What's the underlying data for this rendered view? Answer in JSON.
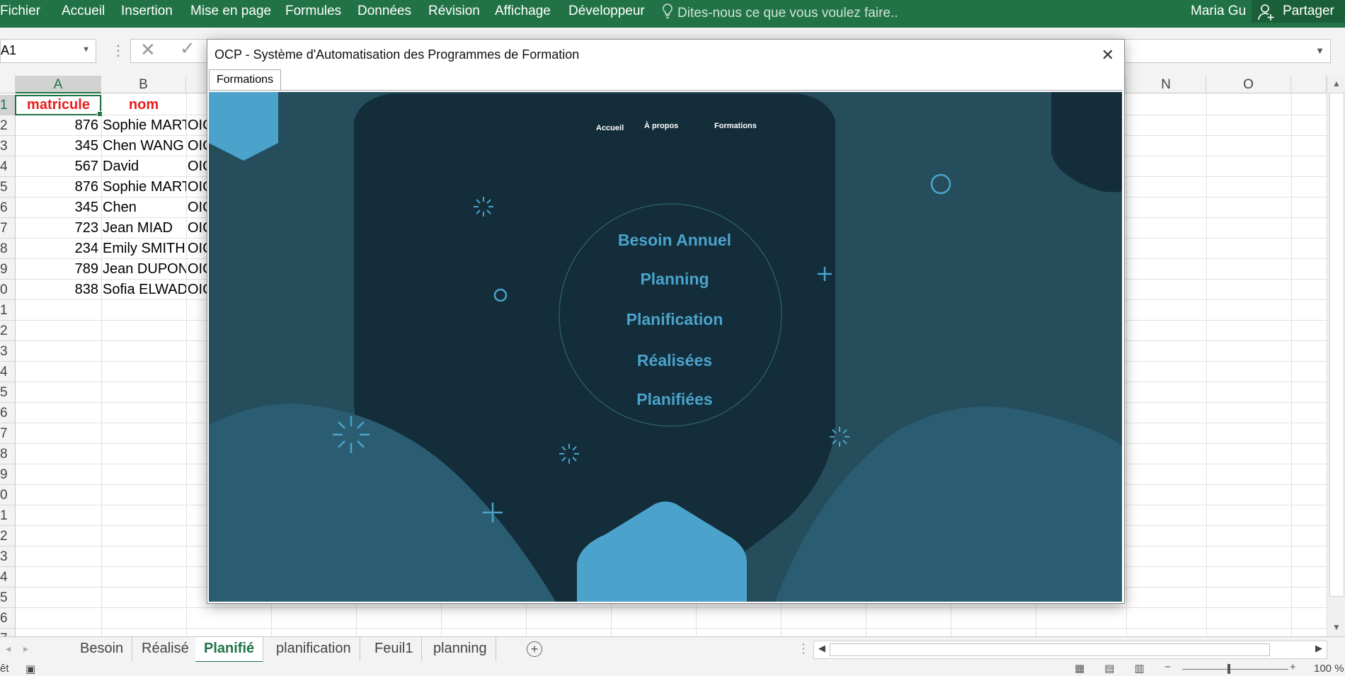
{
  "ribbon": {
    "tabs": [
      "Fichier",
      "Accueil",
      "Insertion",
      "Mise en page",
      "Formules",
      "Données",
      "Révision",
      "Affichage",
      "Développeur"
    ],
    "tell_me": "Dites-nous ce que vous voulez faire..",
    "user": "Maria Gu",
    "share": "Partager"
  },
  "formula_bar": {
    "name_box": "A1"
  },
  "grid": {
    "columns": [
      "A",
      "B",
      "N",
      "O"
    ],
    "row_numbers": [
      "1",
      "2",
      "3",
      "4",
      "5",
      "6",
      "7",
      "8",
      "9",
      "0",
      "1",
      "2",
      "3",
      "4",
      "5",
      "6",
      "7",
      "8",
      "9",
      "0",
      "1",
      "2",
      "3",
      "4",
      "5",
      "6",
      "7"
    ],
    "header": {
      "a": "matricule",
      "b": "nom"
    },
    "rows": [
      {
        "a": "876",
        "b": "Sophie MART",
        "c": "OIC"
      },
      {
        "a": "345",
        "b": "Chen WANG",
        "c": "OIC"
      },
      {
        "a": "567",
        "b": "David",
        "c": "OIC"
      },
      {
        "a": "876",
        "b": "Sophie MART",
        "c": "OIC"
      },
      {
        "a": "345",
        "b": "Chen",
        "c": "OIC"
      },
      {
        "a": "723",
        "b": "Jean MIAD",
        "c": "OIC"
      },
      {
        "a": "234",
        "b": "Emily SMITH",
        "c": "OIC"
      },
      {
        "a": "789",
        "b": "Jean DUPON",
        "c": "OIC"
      },
      {
        "a": "838",
        "b": "Sofia ELWAD",
        "c": "OIC"
      }
    ]
  },
  "sheets": {
    "tabs": [
      "Besoin",
      "Réalisé",
      "Planifié",
      "planification",
      "Feuil1",
      "planning"
    ],
    "active": "Planifié"
  },
  "status": {
    "ready": "êt",
    "zoom": "100 %"
  },
  "dialog": {
    "title": "OCP - Système d'Automatisation des Programmes de Formation",
    "tab": "Formations",
    "nav": {
      "home": "Accueil",
      "about": "À propos",
      "formations": "Formations"
    },
    "menu": [
      "Besoin Annuel",
      "Planning",
      "Planification",
      "Réalisées",
      "Planifiées"
    ]
  },
  "colors": {
    "excel_green": "#217346",
    "canvas_bg": "#264d5c",
    "dark_shape": "#132d3a",
    "accent": "#4ba3cc",
    "header_red": "#e81c1c"
  }
}
